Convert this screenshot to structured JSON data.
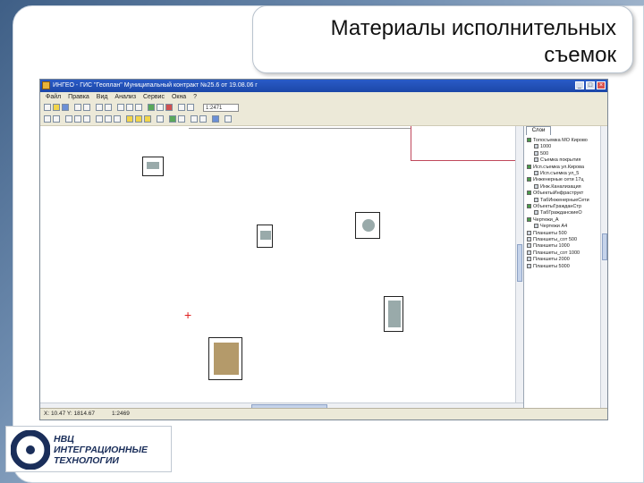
{
  "slide": {
    "title": "Материалы исполнительных съемок"
  },
  "app": {
    "window_title": "ИНГЕО - ГИС \"Геоплан\" Муниципальный контракт №25.6 от 19.08.06 г",
    "window_buttons": [
      "_",
      "□",
      "×"
    ],
    "menu": [
      "Файл",
      "Правка",
      "Вид",
      "Анализ",
      "Сервис",
      "Окна",
      "?"
    ],
    "zoom_value": "1:2471",
    "panel_tab": "Слои",
    "tree": [
      {
        "label": "Топосъемка МО Кирово",
        "level": 0,
        "kind": "group"
      },
      {
        "label": "1000",
        "level": 1,
        "kind": "layer"
      },
      {
        "label": "500",
        "level": 1,
        "kind": "layer"
      },
      {
        "label": "Съемка покрытия",
        "level": 1,
        "kind": "layer"
      },
      {
        "label": "Исп.съемка ул.Кирова",
        "level": 0,
        "kind": "group"
      },
      {
        "label": "Исп.съемка ул_5",
        "level": 1,
        "kind": "layer"
      },
      {
        "label": "Инженерные сети 17ц",
        "level": 0,
        "kind": "group"
      },
      {
        "label": "Инж.Канализация",
        "level": 1,
        "kind": "layer"
      },
      {
        "label": "ОбъектыИнфраструкт",
        "level": 0,
        "kind": "group"
      },
      {
        "label": "ТабИнженерныеСети",
        "level": 1,
        "kind": "layer"
      },
      {
        "label": "ОбъектыГражданСтр",
        "level": 0,
        "kind": "group"
      },
      {
        "label": "ТабГражданскиеО",
        "level": 1,
        "kind": "layer"
      },
      {
        "label": "Чертежи_А",
        "level": 0,
        "kind": "group"
      },
      {
        "label": "Чертежи А4",
        "level": 1,
        "kind": "layer"
      },
      {
        "label": "Планшеты 500",
        "level": 0,
        "kind": "layer"
      },
      {
        "label": "Планшеты_сот 500",
        "level": 0,
        "kind": "layer"
      },
      {
        "label": "Планшеты 1000",
        "level": 0,
        "kind": "layer"
      },
      {
        "label": "Планшеты_сот 1000",
        "level": 0,
        "kind": "layer"
      },
      {
        "label": "Планшеты 2000",
        "level": 0,
        "kind": "layer"
      },
      {
        "label": "Планшеты 5000",
        "level": 0,
        "kind": "layer"
      }
    ],
    "status": {
      "coords": "X: 10.47  Y: 1814.67",
      "scale": "1:2469"
    }
  },
  "logo": {
    "line1": "НВЦ",
    "line2": "ИНТЕГРАЦИОННЫЕ",
    "line3": "ТЕХНОЛОГИИ"
  },
  "colors": {
    "titlebar": "#2a5bc7",
    "boundary_line": "#c0485c",
    "cursor": "#e02020",
    "logo_blue": "#1a2e5a"
  }
}
